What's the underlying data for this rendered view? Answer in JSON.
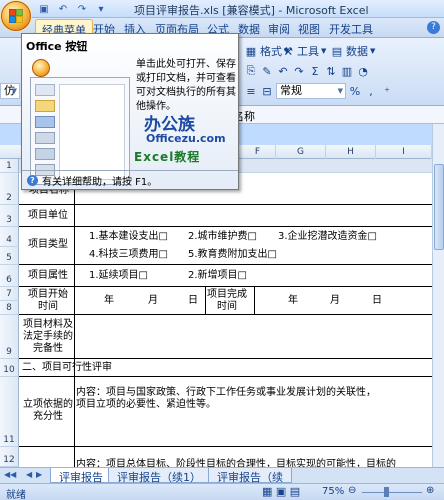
{
  "window": {
    "title": "项目评审报告.xls  [兼容模式] - Microsoft Excel"
  },
  "ribbon": {
    "tabs": [
      "经典菜单",
      "开始",
      "插入",
      "页面布局",
      "公式",
      "数据",
      "审阅",
      "视图",
      "开发工具"
    ],
    "active_tab": "经典菜单",
    "groups": {
      "format_label": "格式",
      "insert_label": "插入",
      "tools_label": "工具",
      "data_label": "数据",
      "number_format": "常规",
      "font_name": "仿"
    }
  },
  "formula_bar": {
    "content": "名称"
  },
  "columns": [
    "F",
    "G",
    "H",
    "I"
  ],
  "sheet": {
    "rows": [
      {
        "num": "2",
        "label": "项目名称"
      },
      {
        "num": "3",
        "label": "项目单位"
      },
      {
        "num": "4",
        "label": "项目类型",
        "options": [
          "1.基本建设支出□",
          "2.城市维护费□",
          "3.企业挖潜改造资金□",
          "4.科技三项费用□",
          "5.教育费附加支出□"
        ]
      },
      {
        "num": "6",
        "label": "项目属性",
        "options": [
          "1.延续项目□",
          "2.新增项目□"
        ]
      },
      {
        "num": "7",
        "label": "项目开始时间",
        "year": "年",
        "month": "月",
        "day": "日",
        "end_label": "项目完成时间"
      },
      {
        "num": "9",
        "label": "项目材料及法定手续的完备性"
      },
      {
        "num": "10",
        "section": "二、项目可行性评审"
      },
      {
        "num": "11",
        "label": "立项依据的充分性",
        "content": "内容：项目与国家政策、行政下工作任务或事业发展计划的关联性，项目立项的必要性、紧迫性等。"
      },
      {
        "num": "12",
        "content_partial": "内容：项目总体目标、阶段性目标的合理性，目标实现的可能性，目标的"
      }
    ],
    "row_numbers_top": [
      "1"
    ]
  },
  "sheet_tabs": [
    "评审报告",
    "评审报告（续1）",
    "评审报告（续"
  ],
  "status": {
    "ready": "就绪",
    "zoom": "75%"
  },
  "tooltip": {
    "title": "Office 按钮",
    "description": "单击此处可打开、保存或打印文档，并可查看可对文档执行的所有其他操作。",
    "logo_cn": "办公族",
    "logo_site": "Officezu.com",
    "logo_sub": "Excel教程",
    "help": "有关详细帮助，请按 F1。"
  },
  "colors": {
    "accent": "#15428b",
    "active_tab": "#fff5cc",
    "office_orb": "#f7b13b"
  }
}
